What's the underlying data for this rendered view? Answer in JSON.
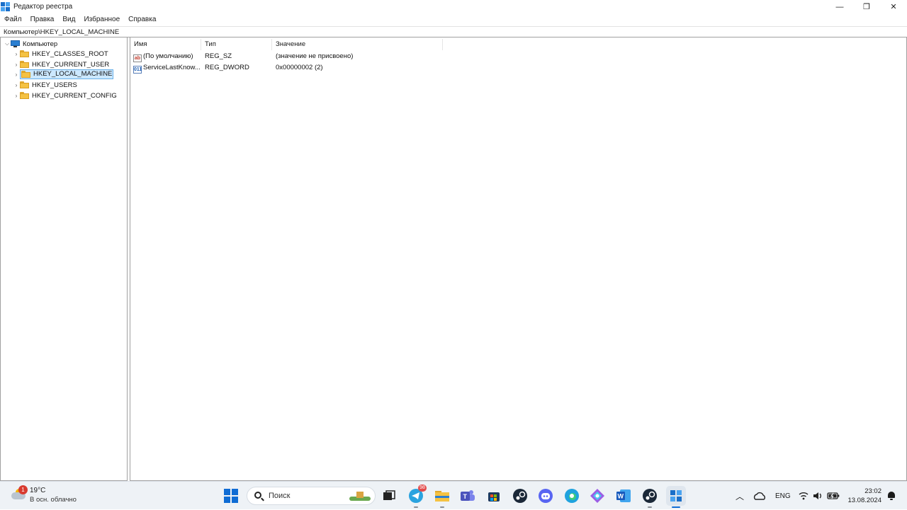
{
  "window": {
    "title": "Редактор реестра",
    "controls": {
      "minimize": "—",
      "restore": "❐",
      "close": "✕"
    }
  },
  "menu": [
    "Файл",
    "Правка",
    "Вид",
    "Избранное",
    "Справка"
  ],
  "address": "Компьютер\\HKEY_LOCAL_MACHINE",
  "tree": {
    "root": {
      "label": "Компьютер",
      "icon": "computer-icon",
      "expanded": true
    },
    "children": [
      {
        "label": "HKEY_CLASSES_ROOT",
        "icon": "folder-icon",
        "selected": false
      },
      {
        "label": "HKEY_CURRENT_USER",
        "icon": "folder-icon",
        "selected": false
      },
      {
        "label": "HKEY_LOCAL_MACHINE",
        "icon": "folder-icon",
        "selected": true
      },
      {
        "label": "HKEY_USERS",
        "icon": "folder-icon",
        "selected": false
      },
      {
        "label": "HKEY_CURRENT_CONFIG",
        "icon": "folder-icon",
        "selected": false
      }
    ]
  },
  "list": {
    "columns": [
      "Имя",
      "Тип",
      "Значение"
    ],
    "rows": [
      {
        "icon": "reg-sz-icon",
        "icon_text": "ab",
        "name": "(По умолчанию)",
        "type": "REG_SZ",
        "value": "(значение не присвоено)"
      },
      {
        "icon": "reg-dword-icon",
        "icon_text": "011",
        "name": "ServiceLastKnow...",
        "type": "REG_DWORD",
        "value": "0x00000002 (2)"
      }
    ]
  },
  "taskbar": {
    "weather": {
      "temp": "19°C",
      "condition": "В осн. облачно",
      "badge": "1"
    },
    "search_placeholder": "Поиск",
    "telegram_badge": "98",
    "tray": {
      "language": "ENG",
      "time": "23:02",
      "date": "13.08.2024"
    }
  },
  "colors": {
    "selection_bg": "#cce8ff",
    "selection_border": "#6ab0e6",
    "taskbar_bg": "#eef2f6",
    "folder": "#f5c242",
    "accent": "#0f6cd4"
  }
}
